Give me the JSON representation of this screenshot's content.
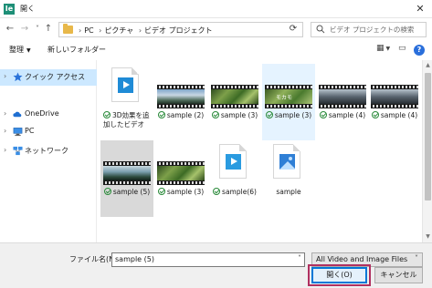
{
  "window": {
    "title": "開く",
    "app_icon_letter": "Ie"
  },
  "nav": {
    "back_icon": "←",
    "forward_icon": "→",
    "recent_icon": "˅",
    "up_icon": "↑",
    "breadcrumbs": [
      "PC",
      "ピクチャ",
      "ビデオ プロジェクト"
    ],
    "refresh_icon": "⟳",
    "search_placeholder": "ビデオ プロジェクトの検索"
  },
  "toolbar": {
    "organize_label": "整理",
    "new_folder_label": "新しいフォルダー"
  },
  "sidebar": {
    "items": [
      {
        "label": "クイック アクセス",
        "icon": "star-icon"
      },
      {
        "label": "OneDrive",
        "icon": "cloud-icon"
      },
      {
        "label": "PC",
        "icon": "computer-icon"
      },
      {
        "label": "ネットワーク",
        "icon": "network-icon"
      }
    ]
  },
  "files": [
    {
      "name": "3D効果を追加したビデオ",
      "kind": "doc-video",
      "synced": true
    },
    {
      "name": "sample (2)",
      "kind": "video",
      "scene": "blue",
      "synced": true
    },
    {
      "name": "sample (3)",
      "kind": "video",
      "scene": "green",
      "synced": true
    },
    {
      "name": "sample (3)",
      "kind": "video",
      "scene": "greentext",
      "synced": true,
      "scene_text": "モカモ"
    },
    {
      "name": "sample (4)",
      "kind": "video",
      "scene": "city",
      "synced": true
    },
    {
      "name": "sample (4)",
      "kind": "video",
      "scene": "city",
      "synced": true
    },
    {
      "name": "sample (5)",
      "kind": "video",
      "scene": "water",
      "synced": true
    },
    {
      "name": "sample (3)",
      "kind": "video",
      "scene": "green",
      "synced": true
    },
    {
      "name": "sample(6)",
      "kind": "doc-video2",
      "synced": true
    },
    {
      "name": "sample",
      "kind": "doc-image",
      "synced": false
    }
  ],
  "footer": {
    "filename_label": "ファイル名(N):",
    "filename_value": "sample (5)",
    "filetype_value": "All Video and Image Files",
    "open_label": "開く(O)",
    "cancel_label": "キャンセル"
  },
  "colors": {
    "selection": "#cce8ff",
    "accent": "#0078d7",
    "highlight_outline": "#b03060"
  }
}
